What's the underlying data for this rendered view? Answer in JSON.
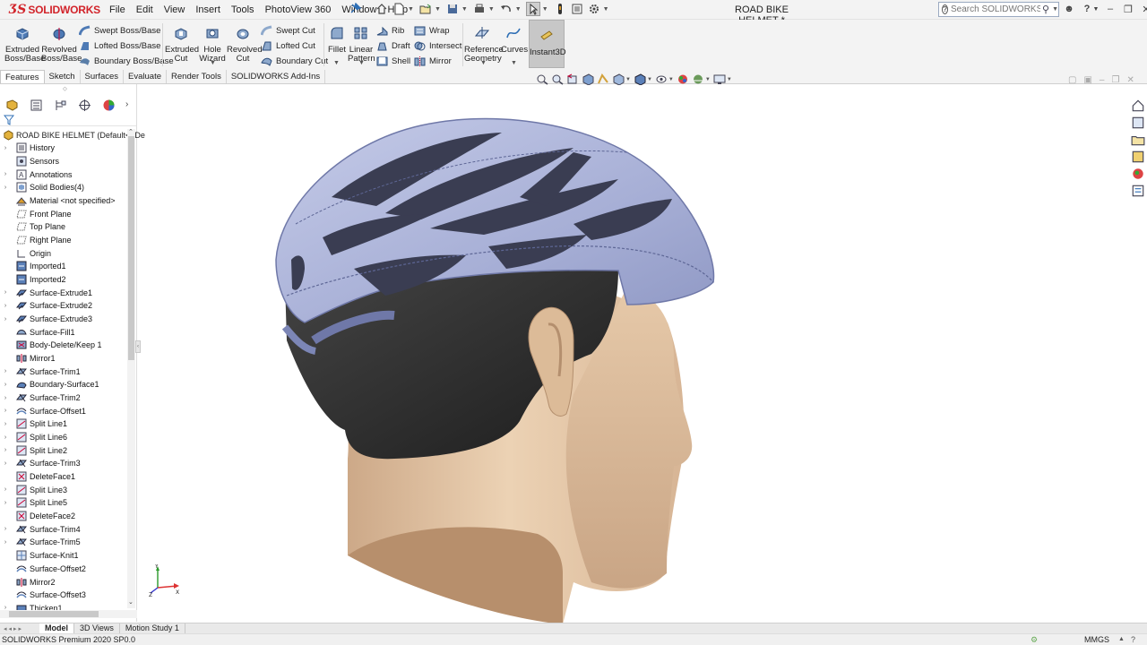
{
  "app": {
    "brand": "SOLIDWORKS",
    "doc_title": "ROAD BIKE HELMET *"
  },
  "menu": [
    "File",
    "Edit",
    "View",
    "Insert",
    "Tools",
    "PhotoView 360",
    "Window",
    "Help"
  ],
  "search": {
    "placeholder": "Search SOLIDWORKS Help"
  },
  "ribbon": {
    "extruded_boss": "Extruded Boss/Base",
    "revolved_boss": "Revolved Boss/Base",
    "swept_boss": "Swept Boss/Base",
    "lofted_boss": "Lofted Boss/Base",
    "boundary_boss": "Boundary Boss/Base",
    "extruded_cut": "Extruded Cut",
    "hole_wizard": "Hole Wizard",
    "revolved_cut": "Revolved Cut",
    "swept_cut": "Swept Cut",
    "lofted_cut": "Lofted Cut",
    "boundary_cut": "Boundary Cut",
    "fillet": "Fillet",
    "linear_pattern": "Linear Pattern",
    "rib": "Rib",
    "draft": "Draft",
    "shell": "Shell",
    "wrap": "Wrap",
    "intersect": "Intersect",
    "mirror": "Mirror",
    "reference_geometry": "Reference Geometry",
    "curves": "Curves",
    "instant3d": "Instant3D"
  },
  "tabs": [
    "Features",
    "Sketch",
    "Surfaces",
    "Evaluate",
    "Render Tools",
    "SOLIDWORKS Add-Ins"
  ],
  "feature_tree": {
    "root": "ROAD BIKE HELMET  (Default<<De",
    "items": [
      {
        "label": "History",
        "expand": true,
        "icon": "history-icon"
      },
      {
        "label": "Sensors",
        "expand": false,
        "icon": "sensor-icon"
      },
      {
        "label": "Annotations",
        "expand": true,
        "icon": "annotation-icon"
      },
      {
        "label": "Solid Bodies(4)",
        "expand": true,
        "icon": "solid-bodies-icon"
      },
      {
        "label": "Material <not specified>",
        "expand": false,
        "icon": "material-icon"
      },
      {
        "label": "Front Plane",
        "expand": false,
        "icon": "plane-icon"
      },
      {
        "label": "Top Plane",
        "expand": false,
        "icon": "plane-icon"
      },
      {
        "label": "Right Plane",
        "expand": false,
        "icon": "plane-icon"
      },
      {
        "label": "Origin",
        "expand": false,
        "icon": "origin-icon"
      },
      {
        "label": "Imported1",
        "expand": false,
        "icon": "imported-icon"
      },
      {
        "label": "Imported2",
        "expand": false,
        "icon": "imported-icon"
      },
      {
        "label": "Surface-Extrude1",
        "expand": true,
        "icon": "surface-extrude-icon"
      },
      {
        "label": "Surface-Extrude2",
        "expand": true,
        "icon": "surface-extrude-icon"
      },
      {
        "label": "Surface-Extrude3",
        "expand": true,
        "icon": "surface-extrude-icon"
      },
      {
        "label": "Surface-Fill1",
        "expand": false,
        "icon": "surface-fill-icon"
      },
      {
        "label": "Body-Delete/Keep 1",
        "expand": false,
        "icon": "body-delete-icon"
      },
      {
        "label": "Mirror1",
        "expand": false,
        "icon": "mirror-icon"
      },
      {
        "label": "Surface-Trim1",
        "expand": true,
        "icon": "surface-trim-icon"
      },
      {
        "label": "Boundary-Surface1",
        "expand": true,
        "icon": "boundary-surface-icon"
      },
      {
        "label": "Surface-Trim2",
        "expand": true,
        "icon": "surface-trim-icon"
      },
      {
        "label": "Surface-Offset1",
        "expand": true,
        "icon": "surface-offset-icon"
      },
      {
        "label": "Split Line1",
        "expand": true,
        "icon": "split-line-icon"
      },
      {
        "label": "Split Line6",
        "expand": true,
        "icon": "split-line-icon"
      },
      {
        "label": "Split Line2",
        "expand": true,
        "icon": "split-line-icon"
      },
      {
        "label": "Surface-Trim3",
        "expand": true,
        "icon": "surface-trim-icon"
      },
      {
        "label": "DeleteFace1",
        "expand": false,
        "icon": "delete-face-icon"
      },
      {
        "label": "Split Line3",
        "expand": true,
        "icon": "split-line-icon"
      },
      {
        "label": "Split Line5",
        "expand": true,
        "icon": "split-line-icon"
      },
      {
        "label": "DeleteFace2",
        "expand": false,
        "icon": "delete-face-icon"
      },
      {
        "label": "Surface-Trim4",
        "expand": true,
        "icon": "surface-trim-icon"
      },
      {
        "label": "Surface-Trim5",
        "expand": true,
        "icon": "surface-trim-icon"
      },
      {
        "label": "Surface-Knit1",
        "expand": false,
        "icon": "surface-knit-icon"
      },
      {
        "label": "Surface-Offset2",
        "expand": false,
        "icon": "surface-offset-icon"
      },
      {
        "label": "Mirror2",
        "expand": false,
        "icon": "mirror-icon"
      },
      {
        "label": "Surface-Offset3",
        "expand": false,
        "icon": "surface-offset-icon"
      },
      {
        "label": "Thicken1",
        "expand": true,
        "icon": "thicken-icon"
      }
    ]
  },
  "bottom_tabs": [
    "Model",
    "3D Views",
    "Motion Study 1"
  ],
  "status": {
    "version": "SOLIDWORKS Premium 2020 SP0.0",
    "units": "MMGS"
  },
  "colors": {
    "brand_red": "#d2232a",
    "helmet": "#a9b1d6",
    "skin": "#e3c9ad",
    "liner": "#2b2b2b"
  }
}
